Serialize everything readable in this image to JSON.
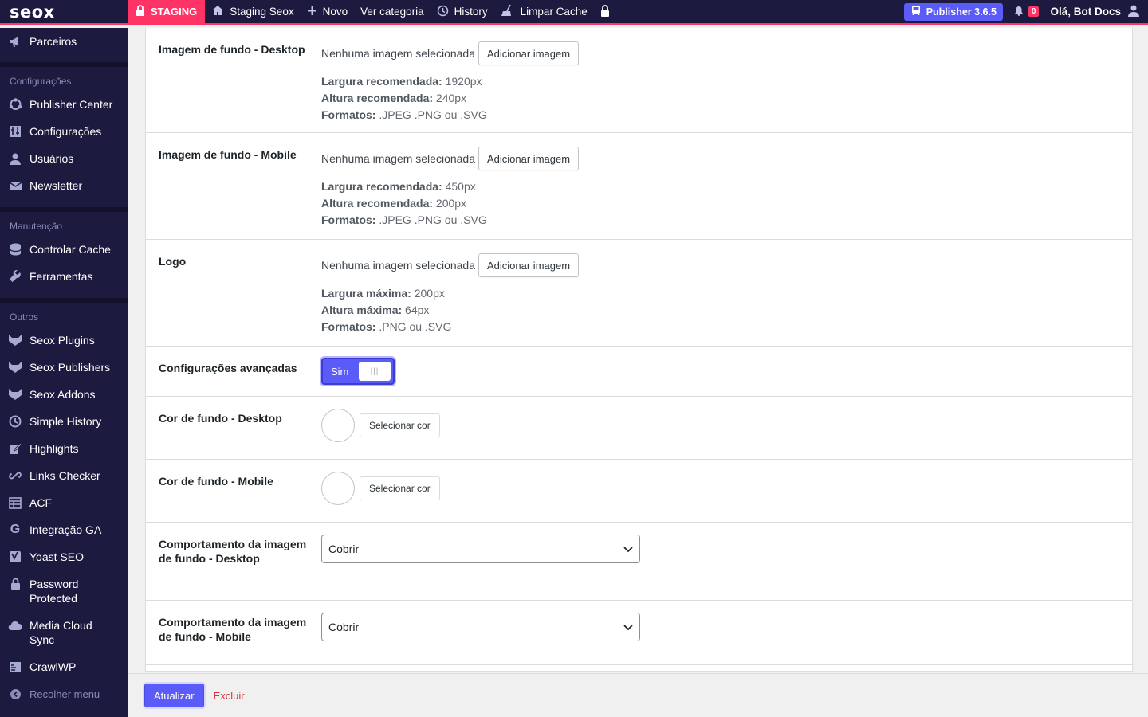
{
  "topbar": {
    "logo": "seox",
    "staging": "STAGING",
    "site_name": "Staging Seox",
    "new": "Novo",
    "view_category": "Ver categoria",
    "history": "History",
    "clear_cache": "Limpar Cache",
    "publisher": "Publisher 3.6.5",
    "notifications": "0",
    "greeting": "Olá, Bot Docs"
  },
  "sidebar": {
    "top_item": "Parceiros",
    "sections": [
      {
        "title": "Configurações",
        "items": [
          "Publisher Center",
          "Configurações",
          "Usuários",
          "Newsletter"
        ]
      },
      {
        "title": "Manutenção",
        "items": [
          "Controlar Cache",
          "Ferramentas"
        ]
      },
      {
        "title": "Outros",
        "items": [
          "Seox Plugins",
          "Seox Publishers",
          "Seox Addons",
          "Simple History",
          "Highlights",
          "Links Checker",
          "ACF",
          "Integração GA",
          "Yoast SEO",
          "Password Protected",
          "Media Cloud Sync",
          "CrawlWP"
        ]
      }
    ],
    "collapse": "Recolher menu"
  },
  "form": {
    "no_image": "Nenhuma imagem selecionada",
    "add_image": "Adicionar imagem",
    "select_color": "Selecionar cor",
    "bg_desktop": {
      "label": "Imagem de fundo - Desktop",
      "h1_k": "Largura recomendada:",
      "h1_v": " 1920px",
      "h2_k": "Altura recomendada:",
      "h2_v": " 240px",
      "h3_k": "Formatos:",
      "h3_v": " .JPEG .PNG ou .SVG"
    },
    "bg_mobile": {
      "label": "Imagem de fundo - Mobile",
      "h1_k": "Largura recomendada:",
      "h1_v": " 450px",
      "h2_k": "Altura recomendada:",
      "h2_v": " 200px",
      "h3_k": "Formatos:",
      "h3_v": " .JPEG .PNG ou .SVG"
    },
    "logo": {
      "label": "Logo",
      "h1_k": "Largura máxima:",
      "h1_v": " 200px",
      "h2_k": "Altura máxima:",
      "h2_v": " 64px",
      "h3_k": "Formatos:",
      "h3_v": " .PNG ou .SVG"
    },
    "advanced": {
      "label": "Configurações avançadas",
      "value": "Sim"
    },
    "color_desktop": {
      "label": "Cor de fundo - Desktop"
    },
    "color_mobile": {
      "label": "Cor de fundo - Mobile"
    },
    "behavior_desktop": {
      "label": "Comportamento da imagem de fundo - Desktop",
      "value": "Cobrir"
    },
    "behavior_mobile": {
      "label": "Comportamento da imagem de fundo - Mobile",
      "value": "Cobrir"
    }
  },
  "footer": {
    "update": "Atualizar",
    "delete": "Excluir"
  },
  "colors": {
    "accent": "#5b5bf7",
    "staging": "#ff3366",
    "sidebar_bg": "#1d1a3f"
  }
}
